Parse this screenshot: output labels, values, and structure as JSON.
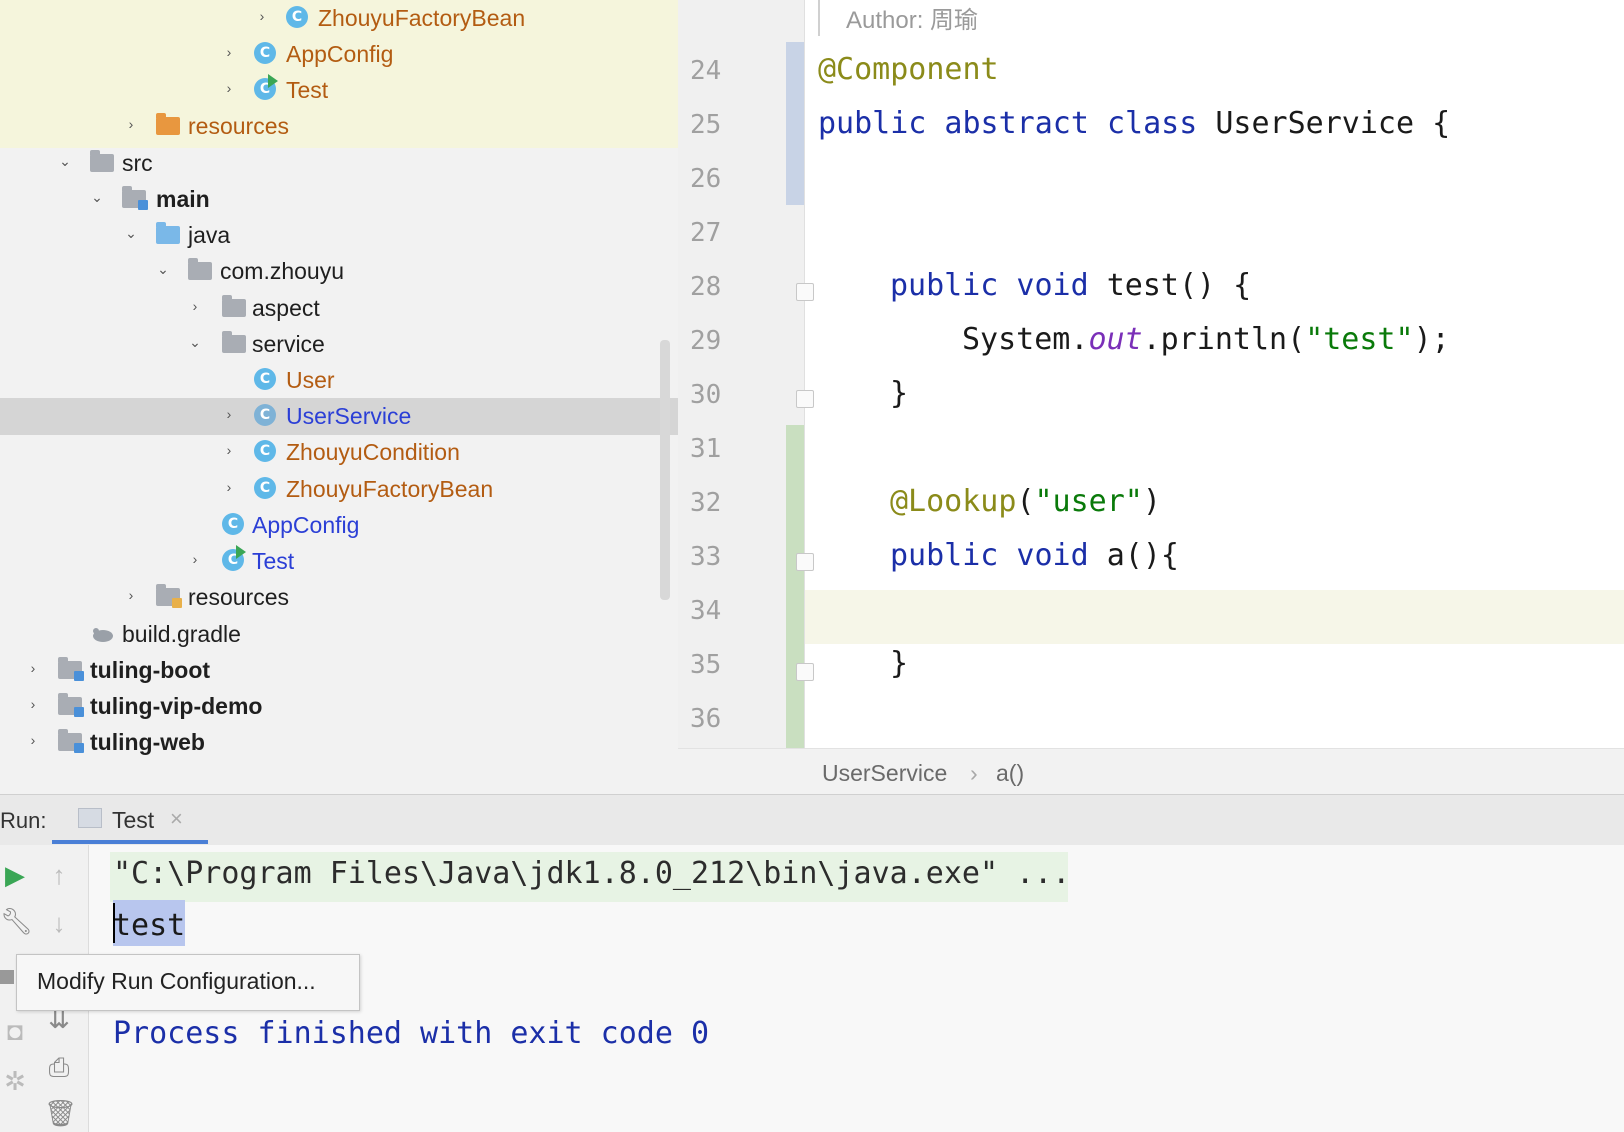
{
  "project_tree": {
    "items": [
      {
        "label": "ZhouyuFactoryBean",
        "kind": "class",
        "style": "orange",
        "expandable": true
      },
      {
        "label": "AppConfig",
        "kind": "class",
        "style": "orange",
        "expandable": true
      },
      {
        "label": "Test",
        "kind": "class-run",
        "style": "orange",
        "expandable": true
      },
      {
        "label": "resources",
        "kind": "folder-orange",
        "style": "orange",
        "expandable": true
      },
      {
        "label": "src",
        "kind": "folder",
        "style": "normal",
        "expanded": true
      },
      {
        "label": "main",
        "kind": "folder-module",
        "style": "bold",
        "expanded": true
      },
      {
        "label": "java",
        "kind": "folder-blue",
        "style": "normal",
        "expanded": true
      },
      {
        "label": "com.zhouyu",
        "kind": "folder",
        "style": "normal",
        "expanded": true
      },
      {
        "label": "aspect",
        "kind": "folder",
        "style": "normal",
        "expandable": true
      },
      {
        "label": "service",
        "kind": "folder",
        "style": "normal",
        "expanded": true
      },
      {
        "label": "User",
        "kind": "class",
        "style": "orange"
      },
      {
        "label": "UserService",
        "kind": "class",
        "style": "blue",
        "selected": true,
        "expandable": true
      },
      {
        "label": "ZhouyuCondition",
        "kind": "class",
        "style": "orange",
        "expandable": true
      },
      {
        "label": "ZhouyuFactoryBean",
        "kind": "class",
        "style": "orange",
        "expandable": true
      },
      {
        "label": "AppConfig",
        "kind": "class",
        "style": "blue"
      },
      {
        "label": "Test",
        "kind": "class-run",
        "style": "blue",
        "expandable": true
      },
      {
        "label": "resources",
        "kind": "folder-resources",
        "style": "normal",
        "expandable": true
      },
      {
        "label": "build.gradle",
        "kind": "gradle",
        "style": "normal"
      },
      {
        "label": "tuling-boot",
        "kind": "module",
        "style": "bold",
        "expandable": true
      },
      {
        "label": "tuling-vip-demo",
        "kind": "module",
        "style": "bold",
        "expandable": true
      },
      {
        "label": "tuling-web",
        "kind": "module",
        "style": "bold",
        "expandable": true
      }
    ]
  },
  "editor": {
    "author_comment": "Author: 周瑜",
    "line_numbers": [
      "24",
      "25",
      "26",
      "27",
      "28",
      "29",
      "30",
      "31",
      "32",
      "33",
      "34",
      "35",
      "36"
    ],
    "code": {
      "l24_ann": "@Component",
      "l25_kw": "public abstract class",
      "l25_rest": " UserService {",
      "l28_kw": "public void",
      "l28_rest": " test() {",
      "l29_a": "System.",
      "l29_field": "out",
      "l29_b": ".println(",
      "l29_str": "\"test\"",
      "l29_c": ");",
      "l30": "}",
      "l32_ann": "@Lookup",
      "l32_a": "(",
      "l32_str": "\"user\"",
      "l32_b": ")",
      "l33_kw": "public void",
      "l33_rest": " a(){",
      "l35": "}"
    },
    "breadcrumb": [
      "UserService",
      "a()"
    ],
    "breadcrumb_sep": "›"
  },
  "run_panel": {
    "label": "Run:",
    "tab_label": "Test",
    "tab_close": "×",
    "console": {
      "command": "\"C:\\Program Files\\Java\\jdk1.8.0_212\\bin\\java.exe\" ...",
      "output": "test",
      "exit": "Process finished with exit code 0"
    },
    "tooltip": "Modify Run Configuration..."
  },
  "colors": {
    "accent_blue": "#2b3fd6",
    "keyword": "#1b2fa8",
    "annotation": "#8b8b1a",
    "string": "#0a7a0a",
    "orange_file": "#b35c12"
  }
}
